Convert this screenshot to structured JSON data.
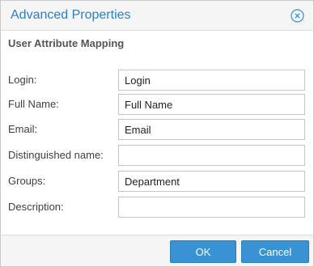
{
  "dialog": {
    "title": "Advanced Properties",
    "close_icon": "close-circle-icon",
    "accent": "#2f7ec4"
  },
  "section": {
    "title": "User Attribute Mapping"
  },
  "fields": [
    {
      "label": "Login:",
      "value": "Login"
    },
    {
      "label": "Full Name:",
      "value": "Full Name"
    },
    {
      "label": "Email:",
      "value": "Email"
    },
    {
      "label": "Distinguished name:",
      "value": ""
    },
    {
      "label": "Groups:",
      "value": "Department"
    },
    {
      "label": "Description:",
      "value": ""
    }
  ],
  "buttons": {
    "ok_label": "OK",
    "cancel_label": "Cancel",
    "color": "#3892d3"
  }
}
